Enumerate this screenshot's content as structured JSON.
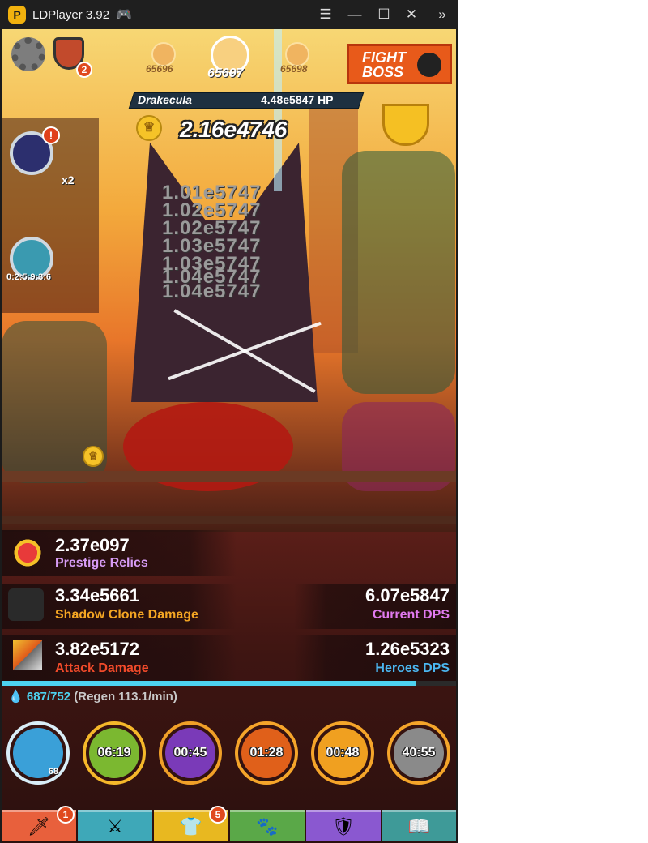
{
  "window": {
    "title": "LDPlayer 3.92",
    "logo_glyph": "P",
    "icons": [
      "gamepad-icon",
      "menu-icon",
      "minimize-icon",
      "maximize-icon",
      "close-icon",
      "expand-icon"
    ]
  },
  "hud": {
    "stage_prev": "65696",
    "stage_current": "65697",
    "stage_next": "65698",
    "fight_boss_line1": "FIGHT",
    "fight_boss_line2": "BOSS",
    "shield_badge": "2",
    "alert_badge": "!",
    "multiplier": "x2",
    "chest_timer": "0:2:5:9:3:6"
  },
  "boss": {
    "name": "Drakecula",
    "hp": "4.48e5847 HP"
  },
  "gold": {
    "amount": "2.16e4746"
  },
  "damage_numbers": [
    "1.01e5747",
    "1.02e5747",
    "1.02e5747",
    "1.03e5747",
    "1.03e5747",
    "1.04e5747",
    "1.04e5747"
  ],
  "stats": {
    "prestige_relics": {
      "value": "2.37e097",
      "label": "Prestige Relics",
      "color": "#d79cf5"
    },
    "shadow_clone": {
      "value": "3.34e5661",
      "label": "Shadow Clone Damage",
      "color": "#f5a623"
    },
    "current_dps": {
      "value": "6.07e5847",
      "label": "Current DPS",
      "color": "#e17af0"
    },
    "attack_damage": {
      "value": "3.82e5172",
      "label": "Attack Damage",
      "color": "#f04a2a"
    },
    "heroes_dps": {
      "value": "1.26e5323",
      "label": "Heroes DPS",
      "color": "#4bb6f0"
    }
  },
  "mana": {
    "current": "687/752",
    "regen": "(Regen 113.1/min)",
    "fill_fraction": 0.91
  },
  "skills": [
    {
      "name": "heavenly-strike",
      "time": "",
      "level": "68",
      "color": "#3aa0d8"
    },
    {
      "name": "deadly-strike",
      "time": "06:19",
      "color": "#7bb830"
    },
    {
      "name": "hand-of-midas",
      "time": "00:45",
      "color": "#7a3ab8"
    },
    {
      "name": "fire-sword",
      "time": "01:28",
      "color": "#e0601a"
    },
    {
      "name": "war-cry",
      "time": "00:48",
      "color": "#f0a020"
    },
    {
      "name": "shadow-clone",
      "time": "40:55",
      "color": "#8a8a8a"
    }
  ],
  "tabs": [
    {
      "name": "sword-master",
      "badge": "1",
      "color": "#e8603c",
      "icon": "sword-icon"
    },
    {
      "name": "heroes",
      "badge": "",
      "color": "#3ea8b8",
      "icon": "helmet-icon"
    },
    {
      "name": "equipment",
      "badge": "5",
      "color": "#e8b820",
      "icon": "shirt-icon"
    },
    {
      "name": "pets",
      "badge": "",
      "color": "#5aa848",
      "icon": "pet-icon"
    },
    {
      "name": "clan",
      "badge": "",
      "color": "#8a58d0",
      "icon": "clan-icon"
    },
    {
      "name": "artifacts",
      "badge": "",
      "color": "#3e9a98",
      "icon": "book-icon"
    }
  ]
}
